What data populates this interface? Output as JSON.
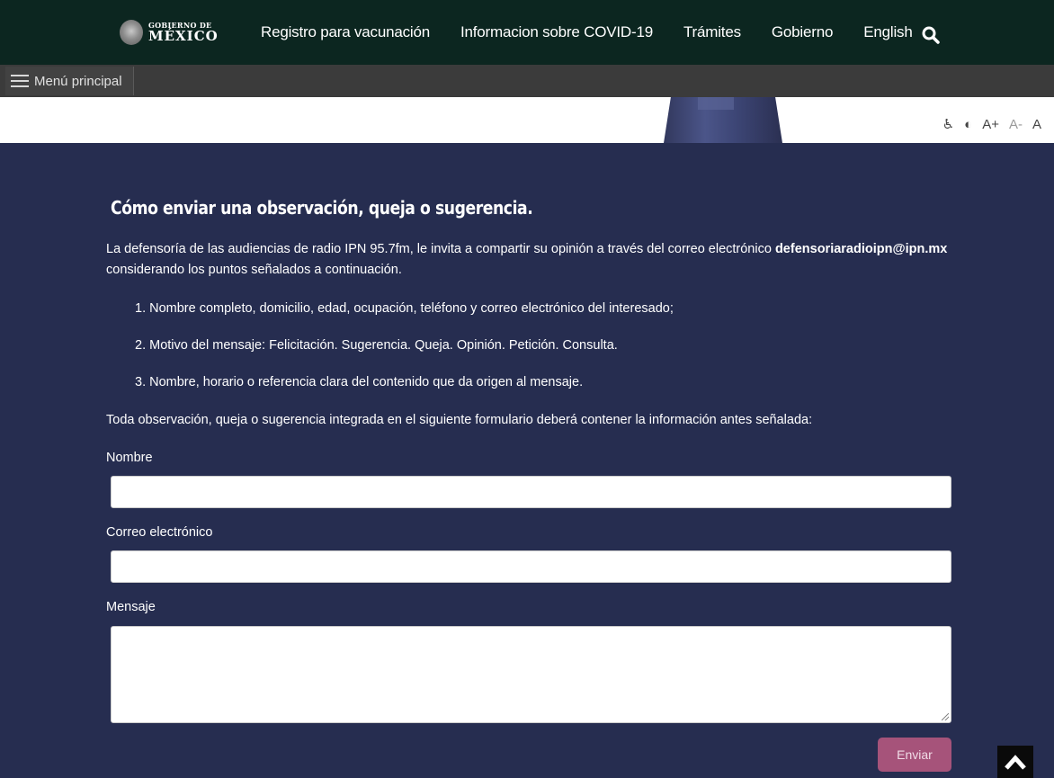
{
  "header": {
    "logo_small": "GOBIERNO DE",
    "logo_big": "MÉXICO",
    "nav": [
      {
        "label": "Registro para vacunación"
      },
      {
        "label": "Informacion sobre COVID-19"
      },
      {
        "label": "Trámites"
      },
      {
        "label": "Gobierno"
      },
      {
        "label": "English"
      }
    ],
    "search_icon": "search-icon"
  },
  "menubar": {
    "label": "Menú principal",
    "icon": "hamburger-icon"
  },
  "accessibility": {
    "wheelchair_icon": "♿",
    "contrast_icon": "◐",
    "increase": "A+",
    "decrease": "A-",
    "reset": "A"
  },
  "content": {
    "title": "Cómo enviar una observación, queja o sugerencia.",
    "intro_before": "La defensoría de las audiencias de radio IPN 95.7fm, le invita a compartir su opinión a través del correo electrónico ",
    "intro_email": "defensoriaradioipn@ipn.mx",
    "intro_after": " considerando los puntos señalados a continuación.",
    "points": [
      "1. Nombre completo, domicilio, edad, ocupación, teléfono y correo electrónico del interesado;",
      "2. Motivo del mensaje: Felicitación. Sugerencia. Queja. Opinión. Petición. Consulta.",
      "3. Nombre, horario o referencia clara del contenido que da origen al mensaje."
    ],
    "form_intro": "Toda observación, queja o sugerencia integrada en el siguiente formulario deberá contener la información antes señalada:"
  },
  "form": {
    "name_label": "Nombre",
    "name_value": "",
    "email_label": "Correo electrónico",
    "email_value": "",
    "message_label": "Mensaje",
    "message_value": "",
    "submit_label": "Enviar"
  },
  "colors": {
    "top_bar": "#0c2620",
    "menu_bar": "#3b3b3b",
    "content_bg": "#262d50",
    "submit_bg": "#a6537a"
  }
}
